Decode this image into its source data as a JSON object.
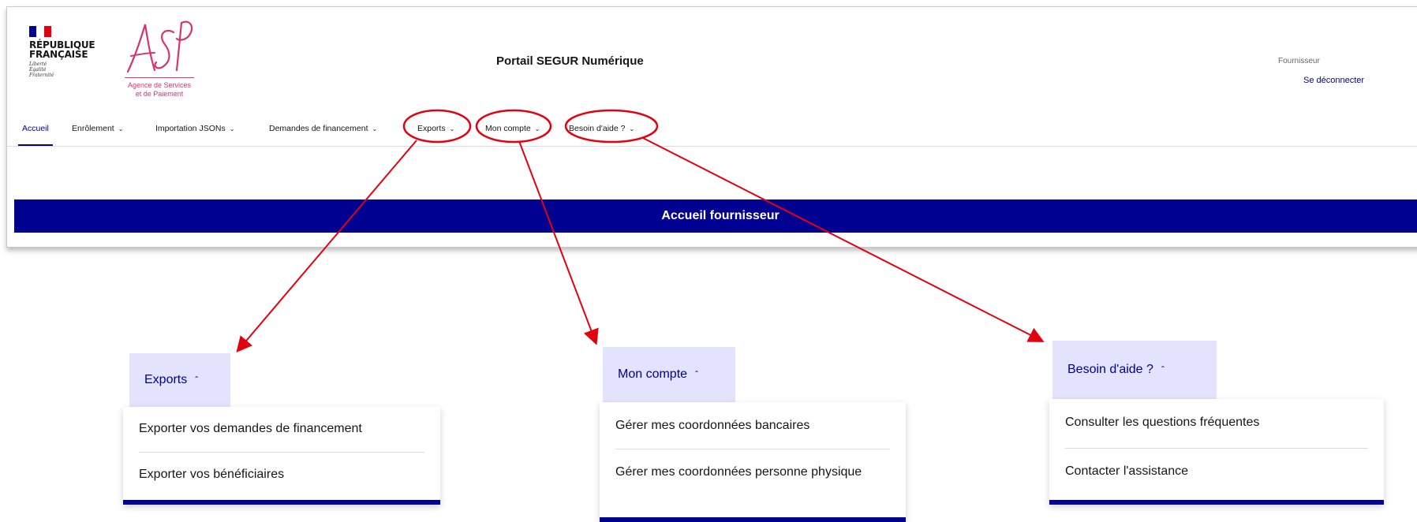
{
  "header": {
    "republic_line1": "RÉPUBLIQUE",
    "republic_line2": "FRANÇAISE",
    "motto_liberte": "Liberté",
    "motto_egalite": "Égalité",
    "motto_fraternite": "Fraternité",
    "asp_logo_text": "ASP",
    "asp_subtitle_line1": "Agence de Services",
    "asp_subtitle_line2": "et de Paiement",
    "portal_title": "Portail SEGUR Numérique",
    "role_label": "Fournisseur",
    "logout_label": "Se déconnecter"
  },
  "nav": {
    "items": [
      {
        "label": "Accueil",
        "active": true
      },
      {
        "label": "Enrôlement",
        "chevron": "chevron-down-icon"
      },
      {
        "label": "Importation JSONs",
        "chevron": "chevron-down-icon"
      },
      {
        "label": "Demandes de financement",
        "chevron": "chevron-down-icon"
      },
      {
        "label": "Exports",
        "chevron": "chevron-down-icon"
      },
      {
        "label": "Mon compte",
        "chevron": "chevron-down-icon"
      },
      {
        "label": "Besoin d'aide ?",
        "chevron": "chevron-down-icon"
      }
    ]
  },
  "banner": {
    "title": "Accueil fournisseur"
  },
  "dropdowns": {
    "exports": {
      "label": "Exports",
      "items": [
        "Exporter vos demandes de financement",
        "Exporter vos bénéficiaires"
      ]
    },
    "account": {
      "label": "Mon compte",
      "items": [
        "Gérer mes coordonnées bancaires",
        "Gérer mes coordonnées personne physique"
      ]
    },
    "help": {
      "label": "Besoin d'aide ?",
      "items": [
        "Consulter les questions fréquentes",
        "Contacter l'assistance"
      ]
    }
  },
  "colors": {
    "primary": "#000091",
    "dropdown_header_bg": "#e3e3fd",
    "annotation": "#e3000f",
    "asp_pink": "#d6356c"
  }
}
